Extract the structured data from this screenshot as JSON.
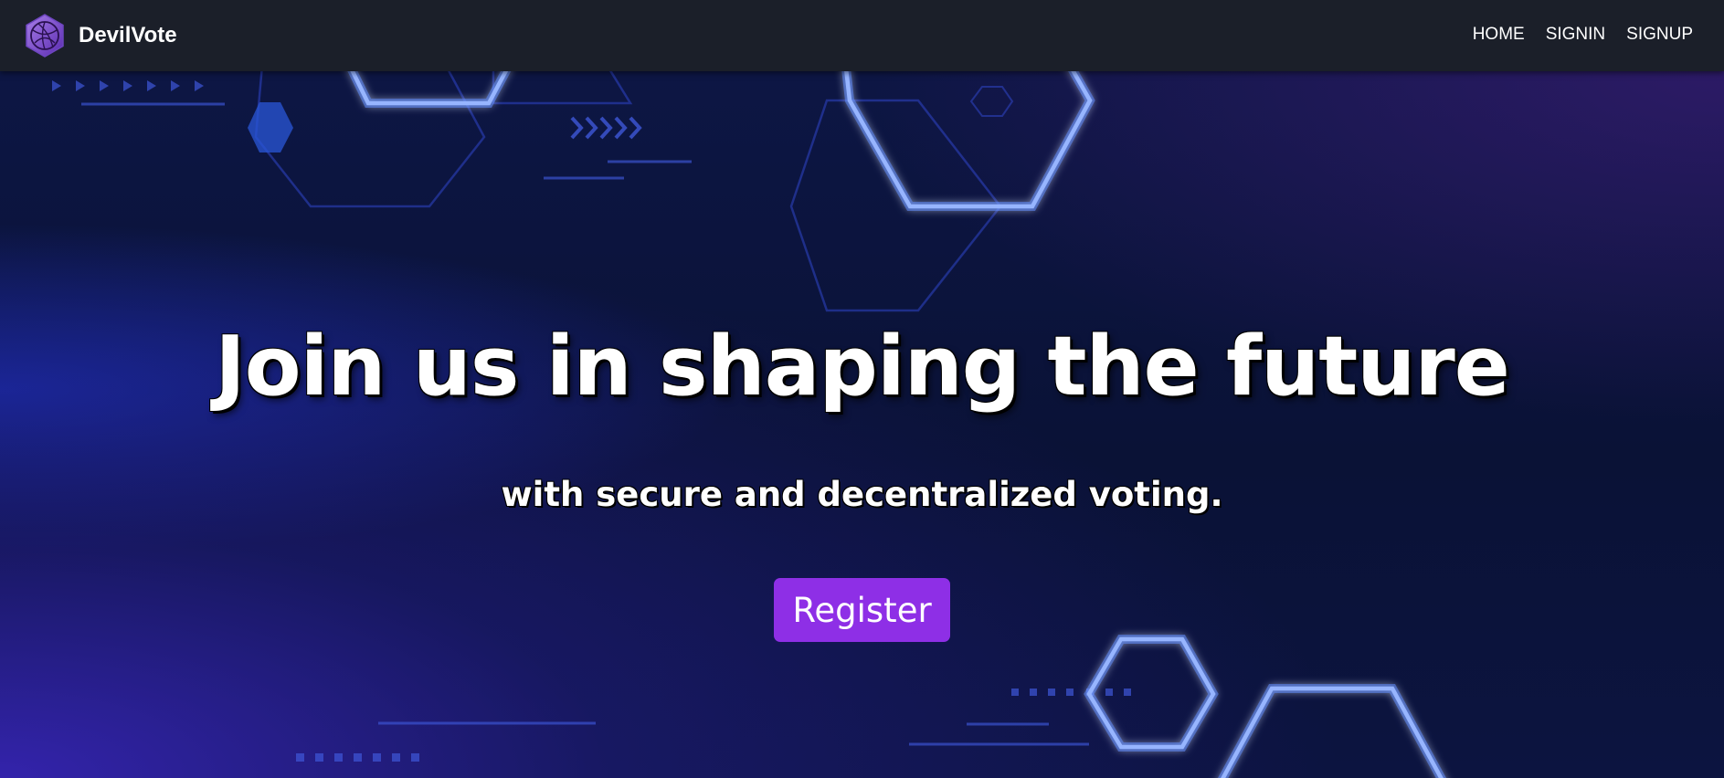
{
  "navbar": {
    "brand_name": "DevilVote",
    "logo_icon": "devilvote-logo-icon",
    "links": [
      {
        "label": "HOME"
      },
      {
        "label": "SIGNIN"
      },
      {
        "label": "SIGNUP"
      }
    ]
  },
  "hero": {
    "headline": "Join us in shaping the future",
    "subheadline": "with secure and decentralized voting.",
    "cta_label": "Register"
  },
  "colors": {
    "navbar_bg": "#1b1f29",
    "hero_bg": "#0b1233",
    "cta_bg": "#8e2fe6",
    "glow": "#cfe1ff"
  }
}
